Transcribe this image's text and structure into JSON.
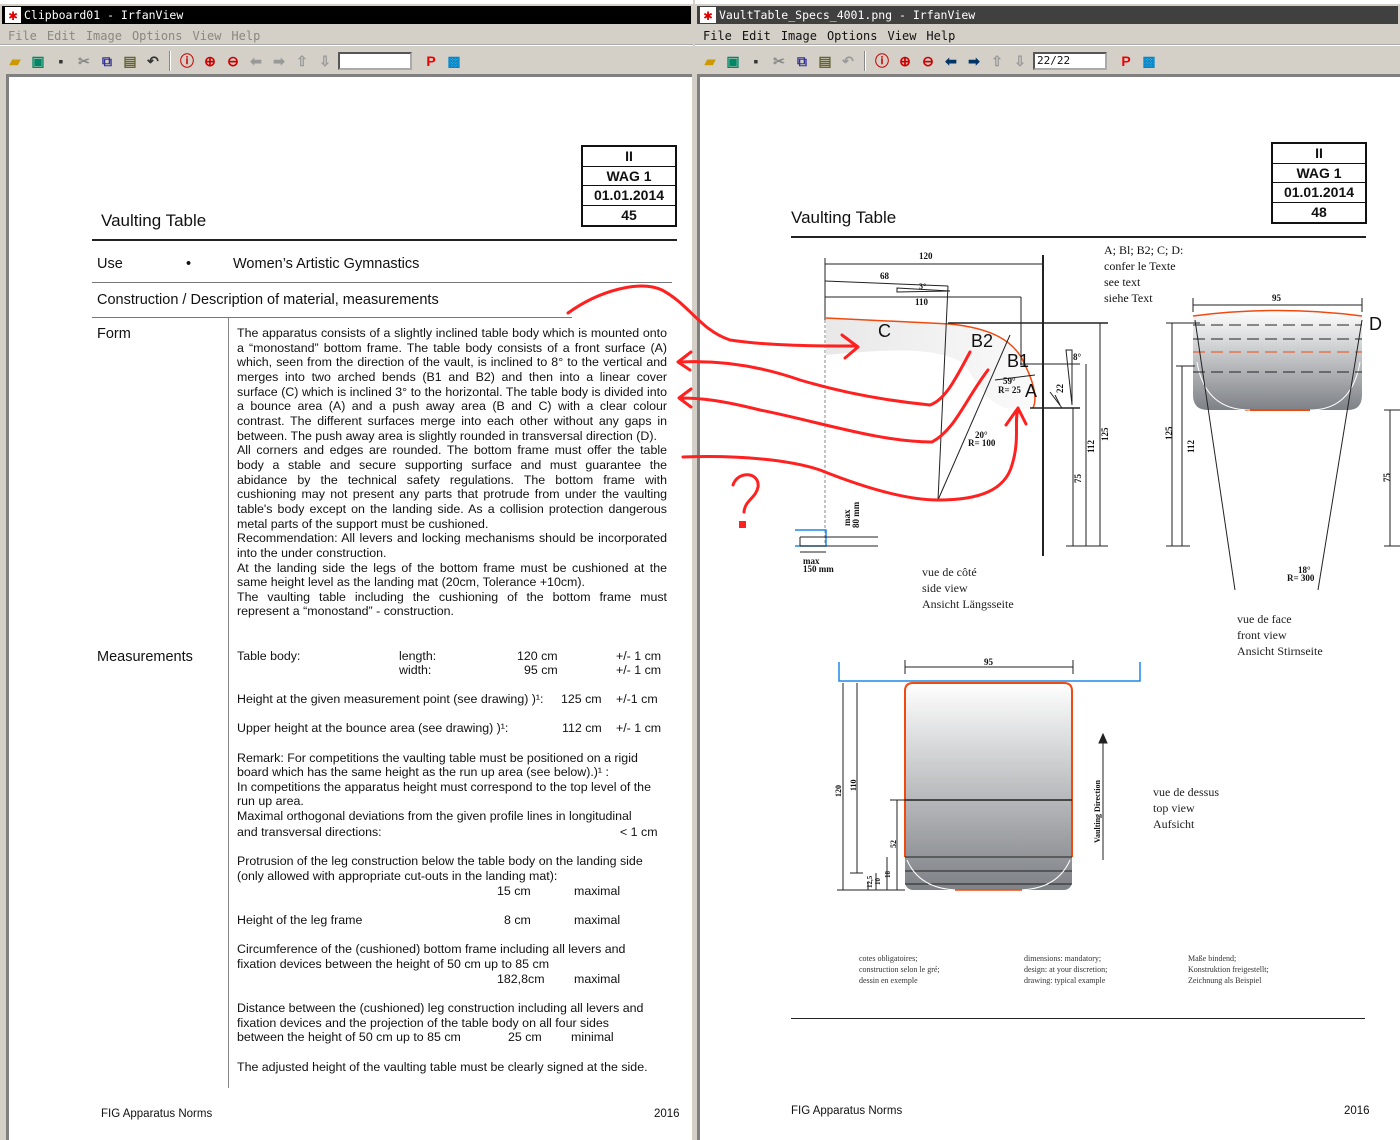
{
  "left_window": {
    "title": "Clipboard01 - IrfanView",
    "menu": [
      "File",
      "Edit",
      "Image",
      "Options",
      "View",
      "Help"
    ],
    "page_field": "",
    "doc": {
      "header_box": [
        "II",
        "WAG 1",
        "01.01.2014",
        "45"
      ],
      "title": "Vaulting Table",
      "use_label": "Use",
      "use_bullet": "•",
      "use_value": "Women’s Artistic Gymnastics",
      "section": "Construction / Description of material, measurements",
      "form_label": "Form",
      "form_paragraphs": [
        "The apparatus consists of a slightly inclined table body which is mounted onto a “monostand” bottom frame. The table body consists of a front surface (A) which, seen from the direction of the vault, is inclined to 8° to the vertical and merges into two arched bends (B1 and B2) and then into a linear cover surface (C) which is inclined 3° to the horizontal. The table body is divided into a bounce area (A) and a push away area (B and C) with a clear colour contrast. The different surfaces merge into each other without any gaps in between. The push away area is slightly rounded in transversal direction (D).",
        "All corners and edges are rounded. The bottom frame must offer the table body a stable and secure supporting surface and must guarantee the abidance by the technical safety regulations. The bottom frame with cushioning may not present any parts that protrude from under the vaulting table's body except on the landing side. As a collision protection dangerous metal parts of the support must be cushioned.",
        "Recommendation: All levers and locking mechanisms should be incorporated into the under construction.",
        "At the landing side the legs of the bottom frame must be cushioned at the same height level as the landing mat (20cm, Tolerance +10cm).",
        "The vaulting table including the cushioning of the bottom frame must represent a “monostand” - construction."
      ],
      "measurements_label": "Measurements",
      "m": {
        "table_body": "Table body:",
        "length": "length:",
        "length_val": "120 cm",
        "length_tol": "+/- 1 cm",
        "width": "width:",
        "width_val": "95 cm",
        "width_tol": "+/- 1 cm",
        "height": "Height at the given measurement point (see drawing) )¹:",
        "height_val": "125 cm",
        "height_tol": "+/-1 cm",
        "upper": "Upper height at the bounce area (see drawing) )¹:",
        "upper_val": "112 cm",
        "upper_tol": "+/- 1 cm",
        "remark1": "Remark: For competitions the vaulting table must be positioned on a rigid",
        "remark2": "board which has the same height as the run up area (see below).)¹ :",
        "remark3": "In competitions the apparatus height must correspond to the top level of the",
        "remark4": "run up area.",
        "dev1": "Maximal orthogonal deviations from the given profile lines in longitudinal",
        "dev2": "and transversal directions:",
        "dev_val": "< 1 cm",
        "prot1": "Protrusion of the leg construction below the table body on the landing side",
        "prot2": "(only allowed with appropriate cut-outs in the landing mat):",
        "prot_val": "15 cm",
        "prot_unit": "maximal",
        "leg": "Height of the leg frame",
        "leg_val": "8 cm",
        "leg_unit": "maximal",
        "circ1": "Circumference of the (cushioned) bottom frame including all levers and",
        "circ2": "fixation devices between the height of 50 cm up to 85 cm",
        "circ_val": "182,8cm",
        "circ_unit": "maximal",
        "dist1": "Distance between the (cushioned) leg construction including all levers and",
        "dist2": "fixation devices and the projection of the table body on all four sides",
        "dist3": "between the height of 50 cm up to 85 cm",
        "dist_val": "25 cm",
        "dist_unit": "minimal",
        "adjusted": "The adjusted height of the vaulting table must be clearly signed at the side."
      },
      "footer_left": "FIG Apparatus Norms",
      "footer_right": "2016"
    }
  },
  "right_window": {
    "title": "VaultTable_Specs_4001.png - IrfanView",
    "menu": [
      "File",
      "Edit",
      "Image",
      "Options",
      "View",
      "Help"
    ],
    "page_field": "22/22",
    "doc": {
      "header_box": [
        "II",
        "WAG 1",
        "01.01.2014",
        "48"
      ],
      "title": "Vaulting Table",
      "legend": [
        "A; Bl; B2; C; D:",
        "confer le Texte",
        "see text",
        "siehe Text"
      ],
      "side": {
        "d120": "120",
        "d68": "68",
        "d3": "3°",
        "d110": "110",
        "C": "C",
        "B2": "B2",
        "B1": "B1",
        "A": "A",
        "a59": "59°",
        "r25": "R= 25",
        "a20": "20°",
        "r100": "R= 100",
        "a8": "8°",
        "d22": "22",
        "d75": "75",
        "d112": "112",
        "d125": "125",
        "max80a": "max",
        "max80b": "80  mm",
        "max150a": "max",
        "max150b": "150  mm",
        "caption": [
          "vue de côté",
          "side view",
          "Ansicht Längsseite"
        ]
      },
      "front": {
        "d95": "95",
        "D": "D",
        "d125": "125",
        "d112": "112",
        "d75": "75",
        "a18": "18°",
        "r300": "R= 300",
        "caption": [
          "vue de face",
          "front view",
          "Ansicht Stirnseite"
        ]
      },
      "top": {
        "d95": "95",
        "d120": "120",
        "d110": "110",
        "d52": "52",
        "d125": "12,5",
        "d10": "10",
        "d18": "18",
        "direction": "Vaulting Direction",
        "caption": [
          "vue de dessus",
          "top view",
          "Aufsicht"
        ]
      },
      "notes": [
        [
          "cotes obligatoires;",
          "construction  selon le gré;",
          "dessin  en exemple"
        ],
        [
          "dimensions: mandatory;",
          "design: at your discretion;",
          "drawing: typical example"
        ],
        [
          "Maße bindend;",
          "Konstruktion  freigestellt;",
          "Zeichnung als Beispiel"
        ]
      ],
      "footer_left": "FIG Apparatus Norms",
      "footer_right": "2016"
    }
  },
  "annotation": {
    "question": "?",
    "color": "#ff2020"
  }
}
